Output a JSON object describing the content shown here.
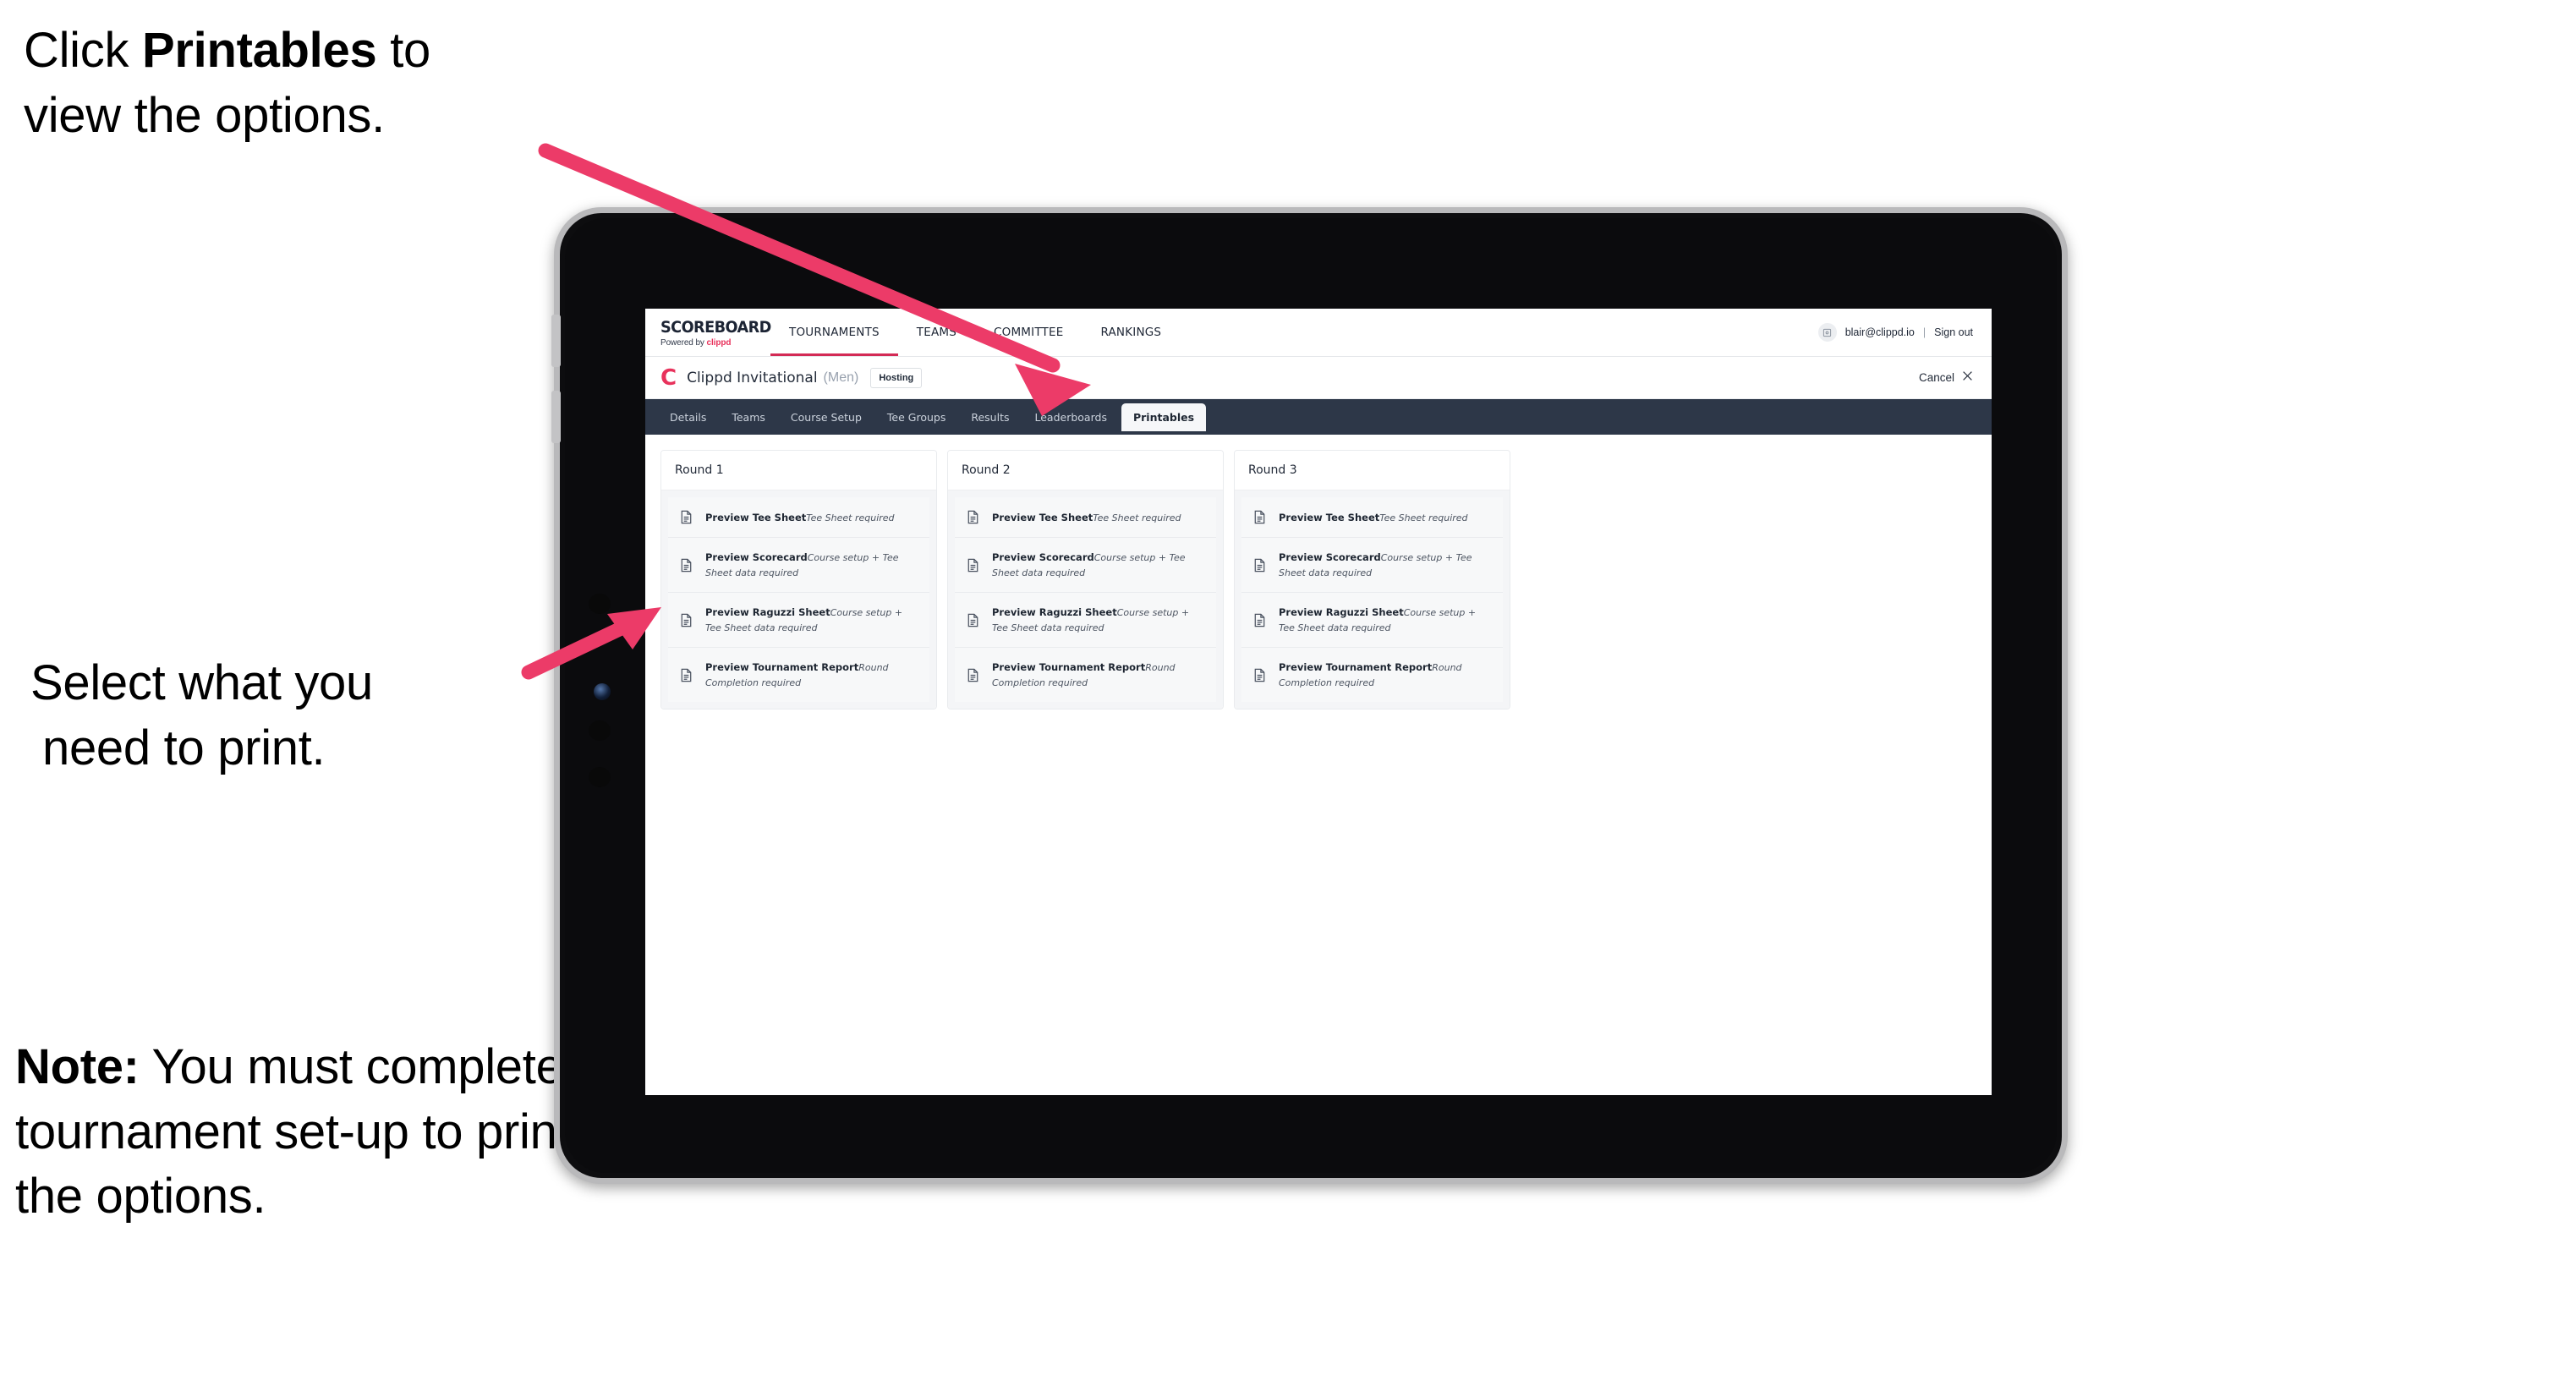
{
  "annotations": {
    "top": {
      "pre": "Click ",
      "bold": "Printables",
      "post": " to",
      "line2": "view the options."
    },
    "middle": {
      "line1": "Select what you",
      "line2": "need to print."
    },
    "note": {
      "bold": "Note:",
      "rest": " You must",
      "line2": "complete the",
      "line3": "tournament set-up",
      "line4": "to print all the options."
    }
  },
  "colors": {
    "arrow": "#ec3b68",
    "brand_pink": "#e8325c",
    "tabbar_dark": "#2d3748",
    "accent_underline": "#d32a55"
  },
  "app": {
    "logo": {
      "main": "SCOREBOARD",
      "powered_prefix": "Powered by ",
      "brand": "clippd"
    },
    "top_nav": [
      {
        "label": "TOURNAMENTS",
        "active": true
      },
      {
        "label": "TEAMS",
        "active": false
      },
      {
        "label": "COMMITTEE",
        "active": false
      },
      {
        "label": "RANKINGS",
        "active": false
      }
    ],
    "account": {
      "avatar_icon": "user-avatar-icon",
      "email": "blair@clippd.io",
      "separator": "|",
      "sign_out": "Sign out"
    },
    "tournament_bar": {
      "mark": "C",
      "name": "Clippd Invitational",
      "gender": "(Men)",
      "badge": "Hosting",
      "cancel": "Cancel",
      "cancel_icon": "close-x-icon"
    },
    "tabs": [
      {
        "label": "Details",
        "active": false
      },
      {
        "label": "Teams",
        "active": false
      },
      {
        "label": "Course Setup",
        "active": false
      },
      {
        "label": "Tee Groups",
        "active": false
      },
      {
        "label": "Results",
        "active": false
      },
      {
        "label": "Leaderboards",
        "active": false
      },
      {
        "label": "Printables",
        "active": true
      }
    ],
    "rounds": [
      {
        "title": "Round 1",
        "items": [
          {
            "title": "Preview Tee Sheet",
            "subtitle": "Tee Sheet required"
          },
          {
            "title": "Preview Scorecard",
            "subtitle": "Course setup + Tee Sheet data required"
          },
          {
            "title": "Preview Raguzzi Sheet",
            "subtitle": "Course setup + Tee Sheet data required"
          },
          {
            "title": "Preview Tournament Report",
            "subtitle": "Round Completion required"
          }
        ]
      },
      {
        "title": "Round 2",
        "items": [
          {
            "title": "Preview Tee Sheet",
            "subtitle": "Tee Sheet required"
          },
          {
            "title": "Preview Scorecard",
            "subtitle": "Course setup + Tee Sheet data required"
          },
          {
            "title": "Preview Raguzzi Sheet",
            "subtitle": "Course setup + Tee Sheet data required"
          },
          {
            "title": "Preview Tournament Report",
            "subtitle": "Round Completion required"
          }
        ]
      },
      {
        "title": "Round 3",
        "items": [
          {
            "title": "Preview Tee Sheet",
            "subtitle": "Tee Sheet required"
          },
          {
            "title": "Preview Scorecard",
            "subtitle": "Course setup + Tee Sheet data required"
          },
          {
            "title": "Preview Raguzzi Sheet",
            "subtitle": "Course setup + Tee Sheet data required"
          },
          {
            "title": "Preview Tournament Report",
            "subtitle": "Round Completion required"
          }
        ]
      }
    ]
  }
}
